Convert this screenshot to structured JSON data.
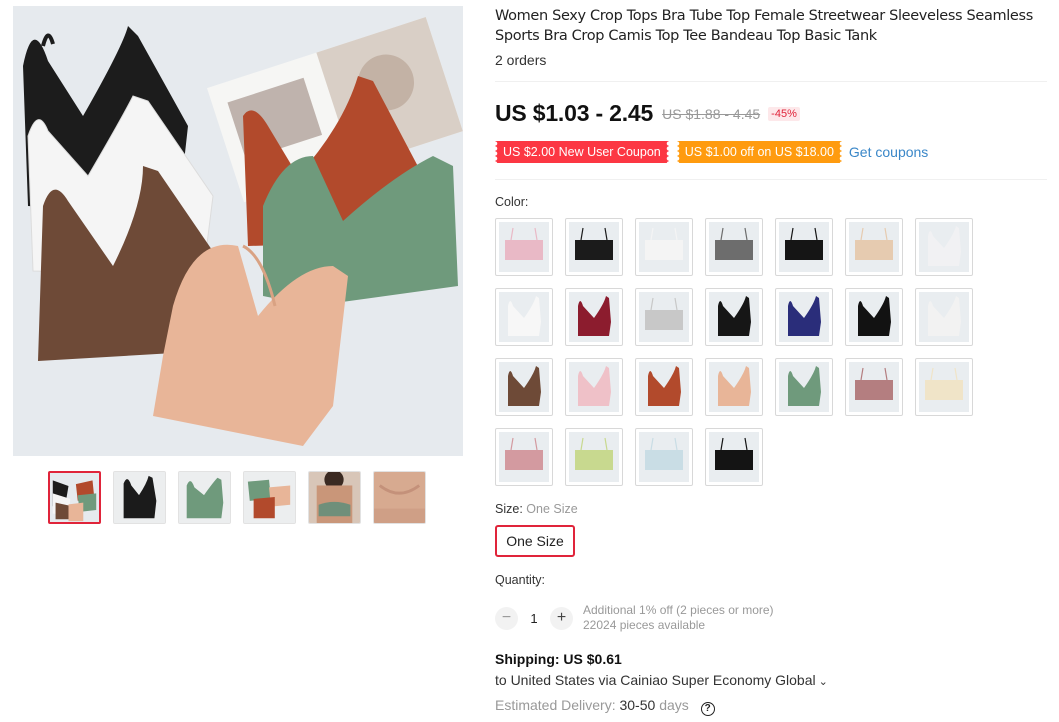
{
  "product": {
    "title": "Women Sexy Crop Tops Bra Tube Top Female Streetwear Sleeveless Seamless Sports Bra Crop Camis Top Tee Bandeau Top Basic Tank",
    "orders": "2 orders",
    "price": "US $1.03 - 2.45",
    "original_price": "US $1.88 - 4.45",
    "discount": "-45%"
  },
  "coupons": {
    "new_user": "US $2.00 New User Coupon",
    "store": "US $1.00 off on US $18.00",
    "get_coupons": "Get coupons"
  },
  "color": {
    "label": "Color:",
    "swatches": [
      {
        "name": "pink-tube",
        "color": "#e9b9c6"
      },
      {
        "name": "black-tube",
        "color": "#1b1b1b"
      },
      {
        "name": "white-tube",
        "color": "#f4f4f4"
      },
      {
        "name": "gray-tube",
        "color": "#6d6d6d"
      },
      {
        "name": "black-bandeau",
        "color": "#151515"
      },
      {
        "name": "nude-tube",
        "color": "#e6cbb0"
      },
      {
        "name": "white-cami",
        "color": "#f1f1f3"
      },
      {
        "name": "white-lace",
        "color": "#f7f7f7"
      },
      {
        "name": "wine-lace",
        "color": "#8c1c2e"
      },
      {
        "name": "light-gray-tube",
        "color": "#c8c8c8"
      },
      {
        "name": "black-lace",
        "color": "#161616"
      },
      {
        "name": "navy-lace",
        "color": "#2a2d7a"
      },
      {
        "name": "black-cami",
        "color": "#121212"
      },
      {
        "name": "white-v-cami",
        "color": "#f2f2f2"
      },
      {
        "name": "brown-cami",
        "color": "#6e4a37"
      },
      {
        "name": "pink-cami",
        "color": "#efc1c8"
      },
      {
        "name": "rust-cami",
        "color": "#b24a2c"
      },
      {
        "name": "apricot-cami",
        "color": "#e8b598"
      },
      {
        "name": "green-cami",
        "color": "#6f9a7c"
      },
      {
        "name": "rose-ribbed",
        "color": "#b47e80"
      },
      {
        "name": "beige-tube",
        "color": "#f0e4c8"
      },
      {
        "name": "dusty-pink-tube",
        "color": "#d39aa0"
      },
      {
        "name": "lime-tube",
        "color": "#c8d98f"
      },
      {
        "name": "ice-blue-tube",
        "color": "#c9dde5"
      },
      {
        "name": "black-strap-tube",
        "color": "#141414"
      }
    ]
  },
  "size": {
    "label": "Size:",
    "selected": "One Size",
    "option": "One Size"
  },
  "quantity": {
    "label": "Quantity:",
    "minus": "−",
    "value": "1",
    "plus": "+",
    "note_discount": "Additional 1% off (2 pieces or more)",
    "note_available": "22024 pieces available"
  },
  "shipping": {
    "title": "Shipping: US $0.61",
    "destination": "to United States via Cainiao Super Economy Global",
    "delivery_label": "Estimated Delivery:",
    "delivery_days": "30-50",
    "delivery_unit": "days",
    "help": "?"
  },
  "gallery": {
    "main_colors": [
      "#1c1c1c",
      "#f4f4f4",
      "#6e4a37",
      "#b24a2c",
      "#6f9a7c",
      "#e8b598"
    ],
    "thumbnails": [
      {
        "name": "thumb-assorted",
        "color": "#6e4a37"
      },
      {
        "name": "thumb-black",
        "color": "#1b1b1b"
      },
      {
        "name": "thumb-green",
        "color": "#6f9a7c"
      },
      {
        "name": "thumb-green-rust",
        "color": "#6f9a7c"
      },
      {
        "name": "thumb-model",
        "color": "#b07a5e"
      },
      {
        "name": "thumb-apricot",
        "color": "#d7aa90"
      }
    ]
  },
  "colors": {
    "accent_red": "#e0243a",
    "coupon_red": "#fc3743",
    "coupon_orange": "#ff9b0f",
    "link_blue": "#3a87c8"
  }
}
